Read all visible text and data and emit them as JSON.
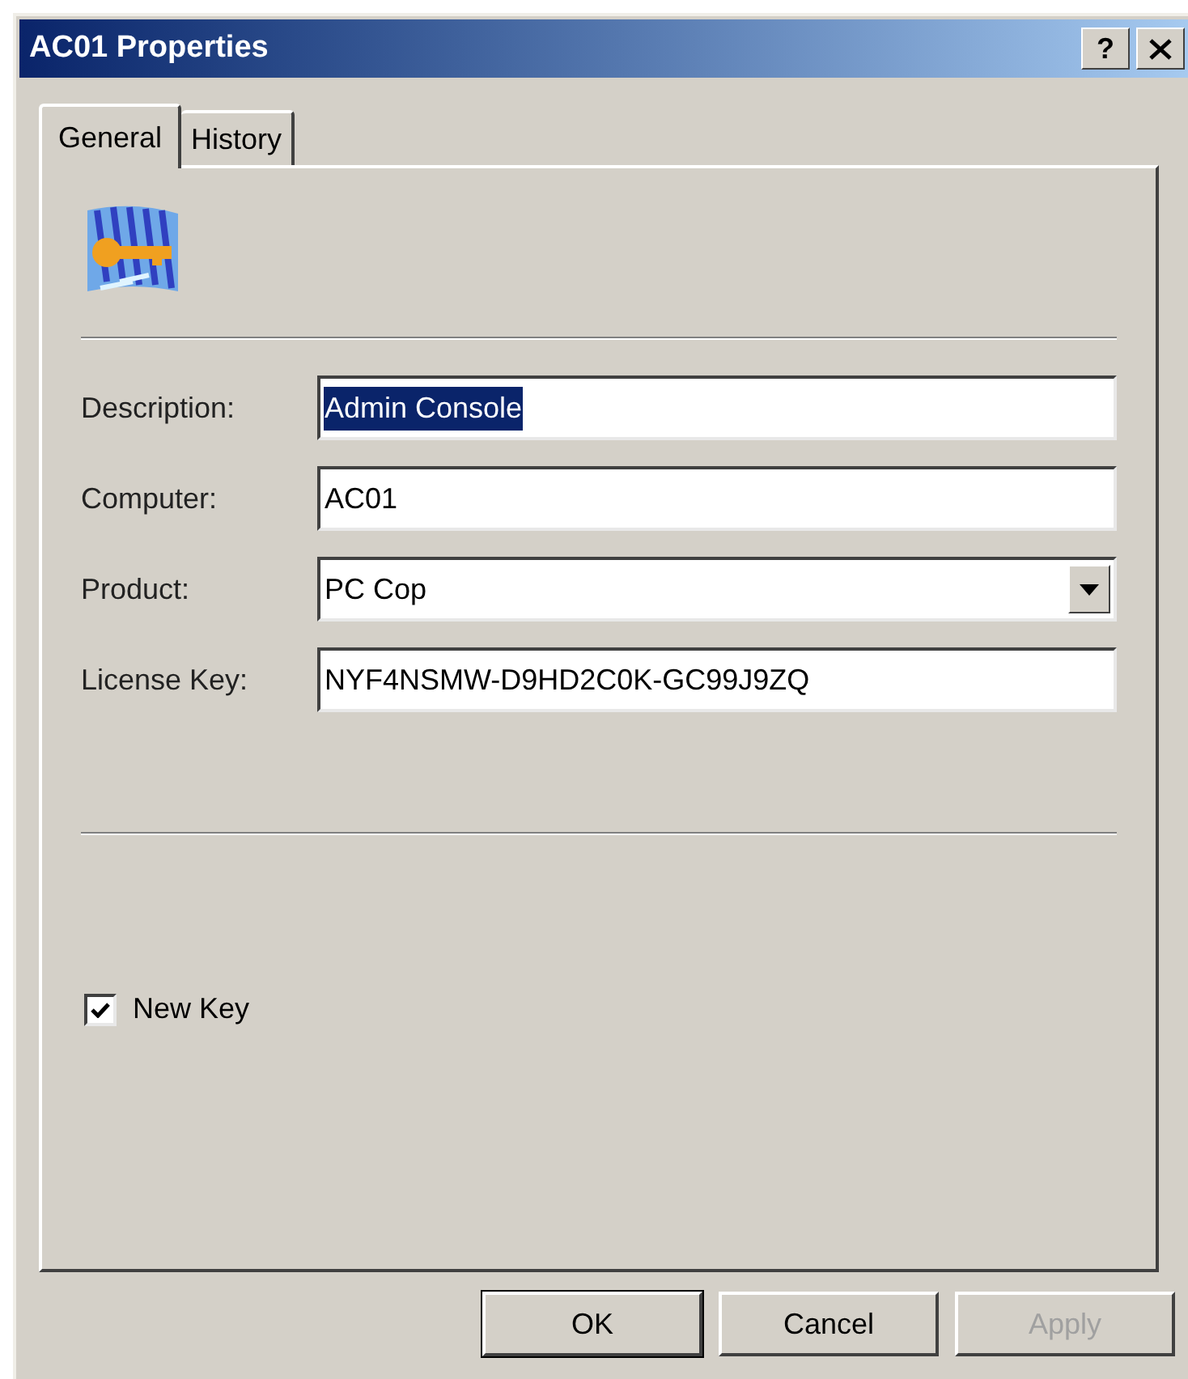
{
  "window": {
    "title": "AC01 Properties",
    "help_button": "?"
  },
  "tabs": [
    {
      "label": "General",
      "selected": true
    },
    {
      "label": "History",
      "selected": false
    }
  ],
  "fields": [
    {
      "kind": "text",
      "label": "Description:",
      "value": "Admin Console",
      "highlighted": true
    },
    {
      "kind": "text",
      "label": "Computer:",
      "value": "AC01",
      "highlighted": false
    },
    {
      "kind": "dropdown",
      "label": "Product:",
      "value": "PC Cop",
      "highlighted": false
    },
    {
      "kind": "text",
      "label": "License Key:",
      "value": "NYF4NSMW-D9HD2C0K-GC99J9ZQ",
      "highlighted": false
    }
  ],
  "checkbox": {
    "label": "New Key",
    "checked": true
  },
  "buttons": [
    {
      "label": "OK",
      "default": true,
      "disabled": false
    },
    {
      "label": "Cancel",
      "default": false,
      "disabled": false
    },
    {
      "label": "Apply",
      "default": false,
      "disabled": true
    }
  ]
}
